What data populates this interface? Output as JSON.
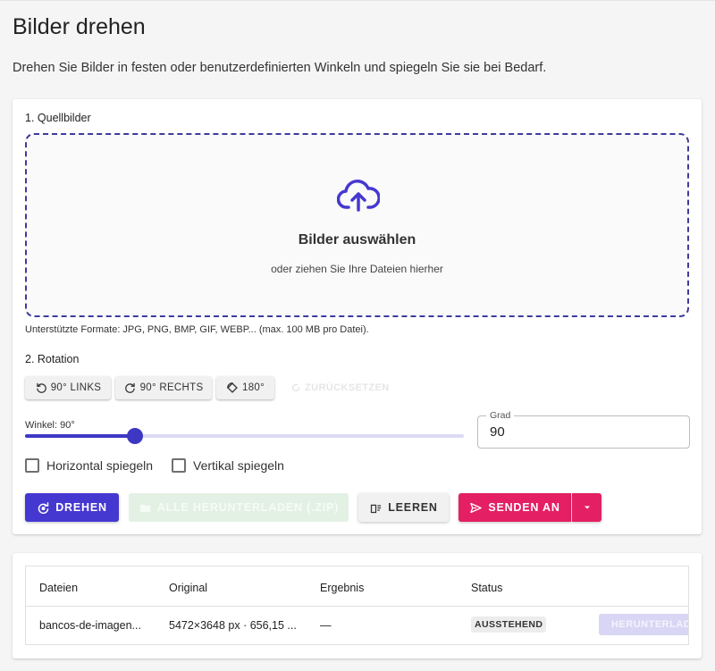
{
  "page": {
    "title": "Bilder drehen",
    "subtitle": "Drehen Sie Bilder in festen oder benutzerdefinierten Winkeln und spiegeln Sie sie bei Bedarf."
  },
  "source": {
    "label": "1. Quellbilder",
    "dropzone_title": "Bilder auswählen",
    "dropzone_sub": "oder ziehen Sie Ihre Dateien hierher",
    "formats": "Unterstützte Formate: JPG, PNG, BMP, GIF, WEBP... (max. 100 MB pro Datei)."
  },
  "rotation": {
    "label": "2. Rotation",
    "presets": [
      "90° LINKS",
      "90° RECHTS",
      "180°"
    ],
    "reset": "ZURÜCKSETZEN",
    "angle_label": "Winkel: 90°",
    "angle_value": 90,
    "angle_max": 360,
    "grad_label": "Grad",
    "grad_value": "90"
  },
  "mirror": {
    "horizontal": "Horizontal spiegeln",
    "vertical": "Vertikal spiegeln"
  },
  "actions": {
    "rotate": "DREHEN",
    "download_all": "ALLE HERUNTERLADEN (.ZIP)",
    "clear": "LEEREN",
    "send_to": "SENDEN AN"
  },
  "table": {
    "headers": [
      "Dateien",
      "Original",
      "Ergebnis",
      "Status"
    ],
    "rows": [
      {
        "file": "bancos-de-imagen...",
        "original": "5472×3648 px · 656,15 ...",
        "result": "—",
        "status": "AUSSTEHEND",
        "download": "HERUNTERLADEN"
      }
    ]
  },
  "colors": {
    "primary": "#4538d0",
    "accent_pink": "#e41f63",
    "dropzone_border": "#3f3a9c"
  },
  "icons": {
    "upload": "cloud-upload-icon",
    "rotate_left": "rotate-left-icon",
    "rotate_right": "rotate-right-icon",
    "rotate_180": "rotate-180-icon",
    "reset": "refresh-icon",
    "rotate": "rotate-action-icon",
    "folder": "folder-zip-icon",
    "clear": "clear-list-icon",
    "send": "send-icon",
    "dropdown": "caret-down-icon",
    "download": "download-icon"
  }
}
